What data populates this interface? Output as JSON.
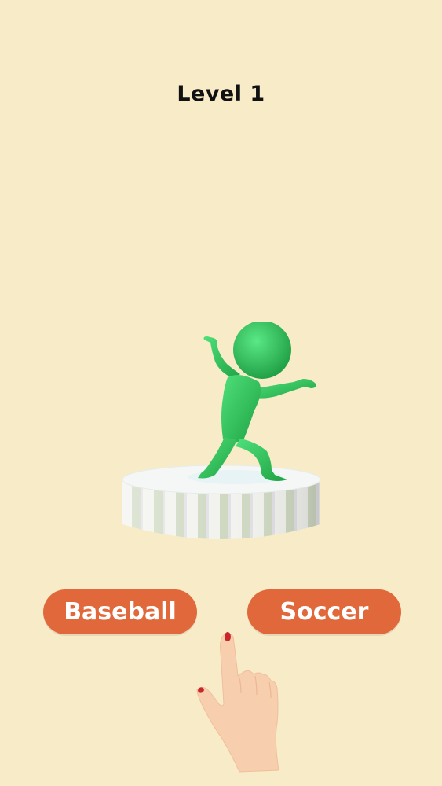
{
  "level": {
    "title": "Level 1"
  },
  "choices": {
    "left_label": "Baseball",
    "right_label": "Soccer"
  },
  "colors": {
    "background": "#f8ebc8",
    "button": "#e0683b",
    "character": "#2fc35a",
    "pedestal_top": "#f4f6f6"
  },
  "icons": {
    "character": "green-stickman-character",
    "pedestal": "striped-round-pedestal",
    "hint": "pointing-hand-icon"
  }
}
